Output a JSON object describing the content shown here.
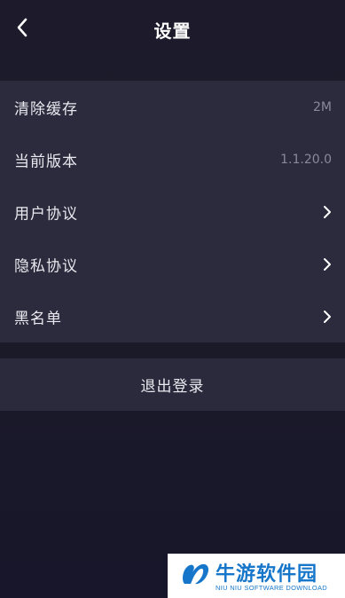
{
  "header": {
    "title": "设置",
    "back_icon": "chevron-left-icon"
  },
  "settings": {
    "rows": [
      {
        "label": "清除缓存",
        "value": "2M",
        "chevron": false
      },
      {
        "label": "当前版本",
        "value": "1.1.20.0",
        "chevron": false
      },
      {
        "label": "用户协议",
        "chevron": true
      },
      {
        "label": "隐私协议",
        "chevron": true
      },
      {
        "label": "黑名单",
        "chevron": true
      }
    ]
  },
  "logout": {
    "label": "退出登录"
  },
  "watermark": {
    "title": "牛游软件园",
    "subtitle": "NIU NIU SOFTWARE DOWNLOAD"
  },
  "colors": {
    "background": "#1c1b2a",
    "card": "#2c2a3d",
    "text": "#e9e8ee",
    "muted": "#8a889b",
    "watermark_blue": "#1676c9"
  }
}
